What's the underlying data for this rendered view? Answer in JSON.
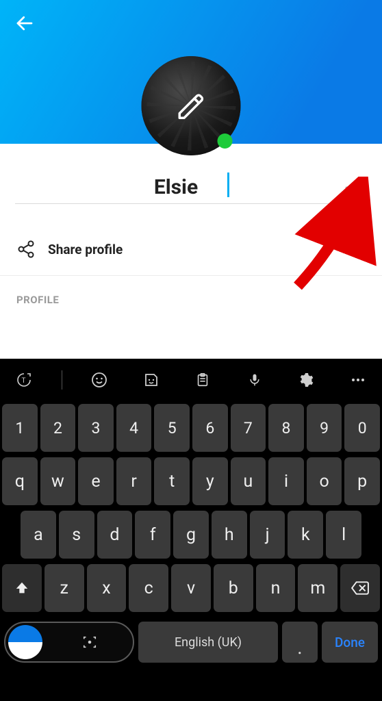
{
  "profile": {
    "name_value": "Elsie",
    "share_label": "Share profile",
    "section_label": "PROFILE"
  },
  "keyboard": {
    "row_num": [
      "1",
      "2",
      "3",
      "4",
      "5",
      "6",
      "7",
      "8",
      "9",
      "0"
    ],
    "row_q": [
      "q",
      "w",
      "e",
      "r",
      "t",
      "y",
      "u",
      "i",
      "o",
      "p"
    ],
    "row_a": [
      "a",
      "s",
      "d",
      "f",
      "g",
      "h",
      "j",
      "k",
      "l"
    ],
    "row_z": [
      "z",
      "x",
      "c",
      "v",
      "b",
      "n",
      "m"
    ],
    "space_label": "English (UK)",
    "done_label": "Done",
    "dot_label": "."
  }
}
